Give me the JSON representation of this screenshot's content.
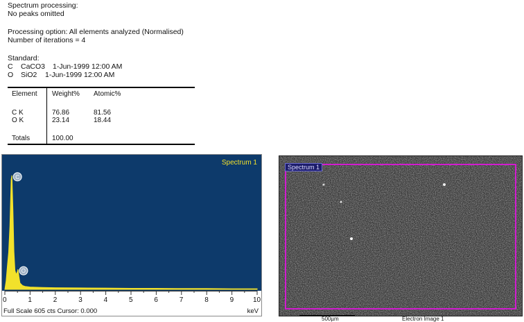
{
  "report": {
    "processing_heading": "Spectrum processing:",
    "peaks_note": "No peaks omitted",
    "processing_option": "Processing option: All elements analyzed (Normalised)",
    "iterations": "Number of iterations = 4",
    "standard_heading": "Standard:",
    "standards": [
      {
        "element": "C",
        "compound": "CaCO3",
        "date": "1-Jun-1999 12:00 AM"
      },
      {
        "element": "O",
        "compound": "SiO2",
        "date": "1-Jun-1999 12:00 AM"
      }
    ]
  },
  "table": {
    "headers": [
      "Element",
      "Weight%",
      "Atomic%"
    ],
    "rows": [
      [
        "C K",
        "76.86",
        "81.56"
      ],
      [
        "O K",
        "23.14",
        "18.44"
      ]
    ],
    "totals_label": "Totals",
    "totals_weight": "100.00"
  },
  "spectrum": {
    "title": "Spectrum 1",
    "footer": "Full Scale 605 cts Cursor: 0.000",
    "unit": "keV",
    "peak_markers": [
      "C",
      "O"
    ],
    "colors": {
      "background": "#0d3a6b",
      "trace": "#f2e12b",
      "title": "#f2e12b"
    }
  },
  "electron_image": {
    "region_label": "Spectrum 1",
    "scale_label": "500µm",
    "title": "Electron Image 1",
    "colors": {
      "region": "#d21bd0"
    }
  },
  "chart_data": {
    "type": "area",
    "title": "Spectrum 1",
    "xlabel": "keV",
    "ylabel": "",
    "xlim": [
      0,
      10
    ],
    "ylim": [
      0,
      605
    ],
    "x_ticks": [
      "0",
      "1",
      "2",
      "3",
      "4",
      "5",
      "6",
      "7",
      "8",
      "9",
      "10"
    ],
    "full_scale_counts": 605,
    "cursor_kev": 0.0,
    "peaks": [
      {
        "label": "C",
        "x": 0.28,
        "y": 540
      },
      {
        "label": "O",
        "x": 0.52,
        "y": 95
      }
    ],
    "series": [
      {
        "values": [
          [
            0.0,
            0
          ],
          [
            0.05,
            40
          ],
          [
            0.1,
            110
          ],
          [
            0.15,
            175
          ],
          [
            0.2,
            300
          ],
          [
            0.25,
            520
          ],
          [
            0.28,
            540
          ],
          [
            0.32,
            380
          ],
          [
            0.36,
            180
          ],
          [
            0.4,
            90
          ],
          [
            0.45,
            70
          ],
          [
            0.5,
            85
          ],
          [
            0.52,
            95
          ],
          [
            0.56,
            60
          ],
          [
            0.6,
            30
          ],
          [
            0.7,
            18
          ],
          [
            0.8,
            14
          ],
          [
            1.0,
            11
          ],
          [
            1.5,
            9
          ],
          [
            2.0,
            8
          ],
          [
            3.0,
            7
          ],
          [
            4.0,
            6
          ],
          [
            5.0,
            5
          ],
          [
            6.0,
            5
          ],
          [
            7.0,
            4
          ],
          [
            8.0,
            4
          ],
          [
            9.0,
            3
          ],
          [
            10.0,
            3
          ]
        ]
      }
    ]
  }
}
